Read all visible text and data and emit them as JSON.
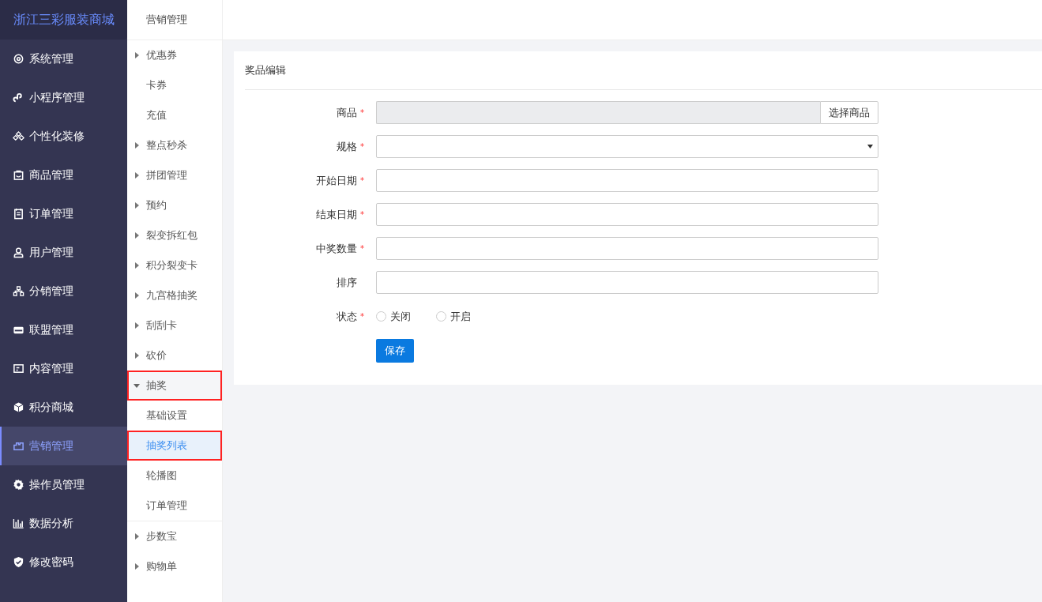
{
  "brand": "浙江三彩服装商城",
  "nav": [
    {
      "label": "系统管理",
      "selected": false
    },
    {
      "label": "小程序管理",
      "selected": false
    },
    {
      "label": "个性化装修",
      "selected": false
    },
    {
      "label": "商品管理",
      "selected": false
    },
    {
      "label": "订单管理",
      "selected": false
    },
    {
      "label": "用户管理",
      "selected": false
    },
    {
      "label": "分销管理",
      "selected": false
    },
    {
      "label": "联盟管理",
      "selected": false
    },
    {
      "label": "内容管理",
      "selected": false
    },
    {
      "label": "积分商城",
      "selected": false
    },
    {
      "label": "营销管理",
      "selected": true
    },
    {
      "label": "操作员管理",
      "selected": false
    },
    {
      "label": "数据分析",
      "selected": false
    },
    {
      "label": "修改密码",
      "selected": false
    }
  ],
  "submenu": {
    "title": "营销管理",
    "items": [
      {
        "label": "优惠券",
        "expanded": false,
        "selected": false,
        "outlined": false
      },
      {
        "label": "卡券",
        "selected": false,
        "outlined": false
      },
      {
        "label": "充值",
        "selected": false,
        "outlined": false
      },
      {
        "label": "整点秒杀",
        "expanded": false,
        "selected": false,
        "outlined": false
      },
      {
        "label": "拼团管理",
        "expanded": false,
        "selected": false,
        "outlined": false
      },
      {
        "label": "预约",
        "expanded": false,
        "selected": false,
        "outlined": false
      },
      {
        "label": "裂变拆红包",
        "expanded": false,
        "selected": false,
        "outlined": false
      },
      {
        "label": "积分裂变卡",
        "expanded": false,
        "selected": false,
        "outlined": false
      },
      {
        "label": "九宫格抽奖",
        "expanded": false,
        "selected": false,
        "outlined": false
      },
      {
        "label": "刮刮卡",
        "expanded": false,
        "selected": false,
        "outlined": false
      },
      {
        "label": "砍价",
        "expanded": false,
        "selected": false,
        "outlined": false
      },
      {
        "label": "抽奖",
        "expanded": true,
        "selected": false,
        "outlined": true,
        "children": [
          {
            "label": "基础设置",
            "selected": false,
            "outlined": false
          },
          {
            "label": "抽奖列表",
            "selected": true,
            "outlined": true
          },
          {
            "label": "轮播图",
            "selected": false,
            "outlined": false
          },
          {
            "label": "订单管理",
            "selected": false,
            "outlined": false
          }
        ]
      },
      {
        "label": "步数宝",
        "expanded": false,
        "selected": false,
        "outlined": false
      },
      {
        "label": "购物单",
        "expanded": false,
        "selected": false,
        "outlined": false
      }
    ]
  },
  "form": {
    "title": "奖品编辑",
    "fields": [
      {
        "kind": "picker",
        "label": "商品",
        "required_mark": "*",
        "button": "选择商品"
      },
      {
        "kind": "select",
        "label": "规格",
        "required_mark": "*"
      },
      {
        "kind": "text",
        "label": "开始日期",
        "required_mark": "*"
      },
      {
        "kind": "text",
        "label": "结束日期",
        "required_mark": "*"
      },
      {
        "kind": "text",
        "label": "中奖数量",
        "required_mark": "*"
      },
      {
        "kind": "text",
        "label": "排序"
      },
      {
        "kind": "radio",
        "label": "状态",
        "required_mark": "*",
        "options": [
          {
            "label": "关闭",
            "selected": false
          },
          {
            "label": "开启",
            "selected": false
          }
        ]
      }
    ],
    "submit": "保存"
  }
}
